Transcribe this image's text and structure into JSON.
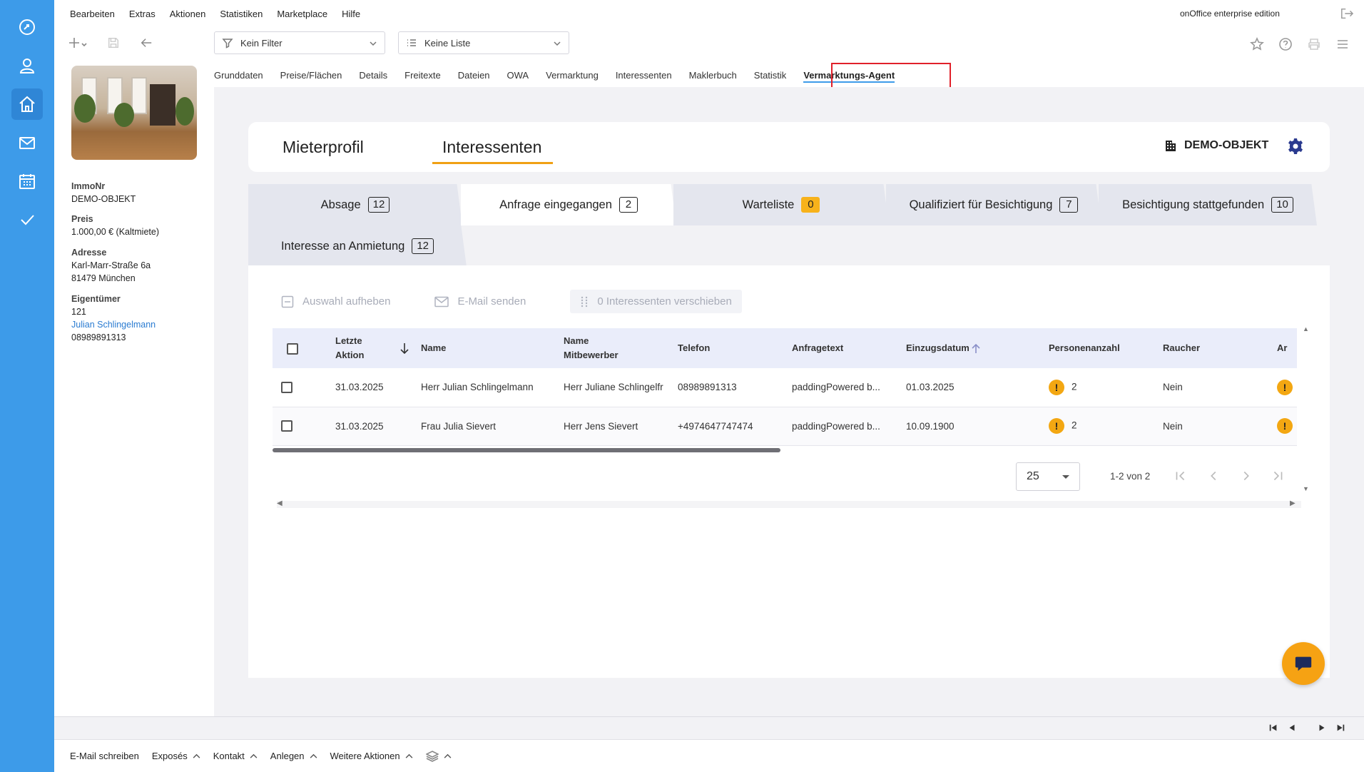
{
  "menu": [
    "Bearbeiten",
    "Extras",
    "Aktionen",
    "Statistiken",
    "Marketplace",
    "Hilfe"
  ],
  "edition": "onOffice enterprise edition",
  "filter": {
    "value": "Kein Filter"
  },
  "list": {
    "value": "Keine Liste"
  },
  "tabs": [
    "Grunddaten",
    "Preise/Flächen",
    "Details",
    "Freitexte",
    "Dateien",
    "OWA",
    "Vermarktung",
    "Interessenten",
    "Maklerbuch",
    "Statistik",
    "Vermarktungs-Agent"
  ],
  "active_tab": "Vermarktungs-Agent",
  "info": {
    "immonr_label": "ImmoNr",
    "immonr": "DEMO-OBJEKT",
    "preis_label": "Preis",
    "preis": "1.000,00 € (Kaltmiete)",
    "adresse_label": "Adresse",
    "adresse_line1": "Karl-Marr-Straße 6a",
    "adresse_line2": "81479 München",
    "eigentuemer_label": "Eigentümer",
    "eigentuemer_nr": "121",
    "eigentuemer_name": "Julian Schlingelmann",
    "eigentuemer_tel": "08989891313"
  },
  "subtabs": {
    "mieterprofil": "Mieterprofil",
    "interessenten": "Interessenten"
  },
  "object_name": "DEMO-OBJEKT",
  "stages": [
    {
      "label": "Absage",
      "count": "12"
    },
    {
      "label": "Anfrage eingegangen",
      "count": "2"
    },
    {
      "label": "Warteliste",
      "count": "0"
    },
    {
      "label": "Qualifiziert für Besichtigung",
      "count": "7"
    },
    {
      "label": "Besichtigung stattgefunden",
      "count": "10"
    },
    {
      "label": "Interesse an Anmietung",
      "count": "12"
    }
  ],
  "actions": {
    "deselect": "Auswahl aufheben",
    "email": "E-Mail senden",
    "move": "0 Interessenten verschieben"
  },
  "table": {
    "headers": {
      "last_action_1": "Letzte",
      "last_action_2": "Aktion",
      "name": "Name",
      "competitor_1": "Name",
      "competitor_2": "Mitbewerber",
      "phone": "Telefon",
      "inquiry": "Anfragetext",
      "move_in": "Einzugsdatum",
      "persons": "Personenanzahl",
      "smoker": "Raucher",
      "cut": "Ar"
    },
    "rows": [
      {
        "date": "31.03.2025",
        "name": "Herr Julian Schlingelmann",
        "competitor": "Herr Juliane Schlingelfr",
        "phone": "08989891313",
        "inquiry": "paddingPowered b...",
        "move_in": "01.03.2025",
        "persons": "2",
        "smoker": "Nein"
      },
      {
        "date": "31.03.2025",
        "name": "Frau Julia Sievert",
        "competitor": "Herr Jens Sievert",
        "phone": "+4974647747474",
        "inquiry": "paddingPowered b...",
        "move_in": "10.09.1900",
        "persons": "2",
        "smoker": "Nein"
      }
    ]
  },
  "pagination": {
    "per_page": "25",
    "range": "1-2 von 2"
  },
  "bottom": [
    "E-Mail schreiben",
    "Exposés",
    "Kontakt",
    "Anlegen",
    "Weitere Aktionen"
  ]
}
